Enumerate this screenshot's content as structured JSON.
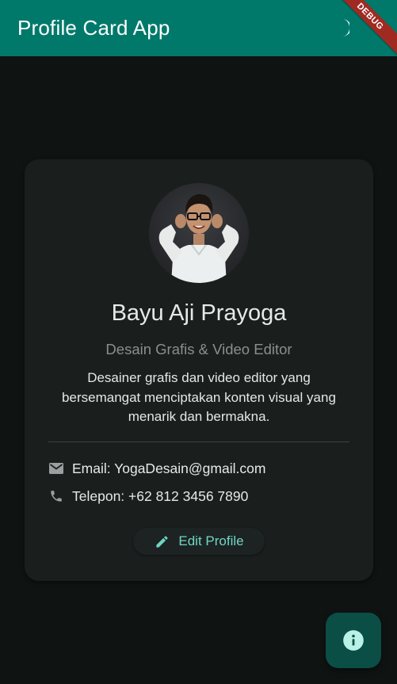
{
  "appbar": {
    "title": "Profile Card App",
    "theme_toggle_icon": "moon-icon",
    "color": "#00796b"
  },
  "debug_banner": {
    "label": "DEBUG",
    "color": "#a02a22"
  },
  "profile": {
    "name": "Bayu Aji Prayoga",
    "role": "Desain Grafis & Video Editor",
    "bio": "Desainer grafis dan video editor yang bersemangat menciptakan konten visual yang menarik dan bermakna.",
    "email_label": "Email: YogaDesain@gmail.com",
    "email_icon": "mail-icon",
    "phone_label": "Telepon: +62 812 3456 7890",
    "phone_icon": "phone-icon"
  },
  "actions": {
    "edit_label": "Edit Profile",
    "edit_icon": "pencil-icon",
    "fab_icon": "info-icon",
    "accent": "#6fd6c4"
  }
}
